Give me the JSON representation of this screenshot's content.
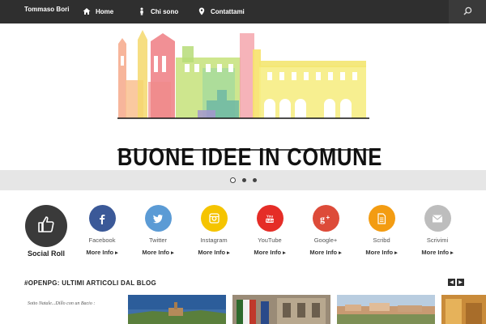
{
  "nav": {
    "brand": "Tommaso Bori",
    "items": [
      {
        "label": "Home",
        "icon": "home-icon"
      },
      {
        "label": "Chi sono",
        "icon": "person-icon"
      },
      {
        "label": "Contattami",
        "icon": "location-pin-icon"
      }
    ],
    "search_icon": "search-icon"
  },
  "banner": {
    "logo_text": "BUONE IDEE IN COMUNE"
  },
  "slider": {
    "dot_count": 3,
    "active_index": 0
  },
  "social_roll": {
    "title": "Social Roll",
    "more_label": "More Info",
    "items": [
      {
        "name": "Facebook",
        "color": "#3b5998",
        "icon": "facebook-icon"
      },
      {
        "name": "Twitter",
        "color": "#5b9bd5",
        "icon": "twitter-icon"
      },
      {
        "name": "Instagram",
        "color": "#f5c400",
        "icon": "instagram-icon"
      },
      {
        "name": "YouTube",
        "color": "#e52d27",
        "icon": "youtube-icon"
      },
      {
        "name": "Google+",
        "color": "#dd4b39",
        "icon": "google-plus-icon"
      },
      {
        "name": "Scribd",
        "color": "#f39c12",
        "icon": "scribd-icon"
      },
      {
        "name": "Scrivimi",
        "color": "#bdbdbd",
        "icon": "mail-icon"
      }
    ]
  },
  "blog": {
    "heading": "#OPENPG: ULTIMI ARTICOLI DAL BLOG",
    "thumb_caption": "Sotto Natale...Dillo con un Bacio :"
  }
}
